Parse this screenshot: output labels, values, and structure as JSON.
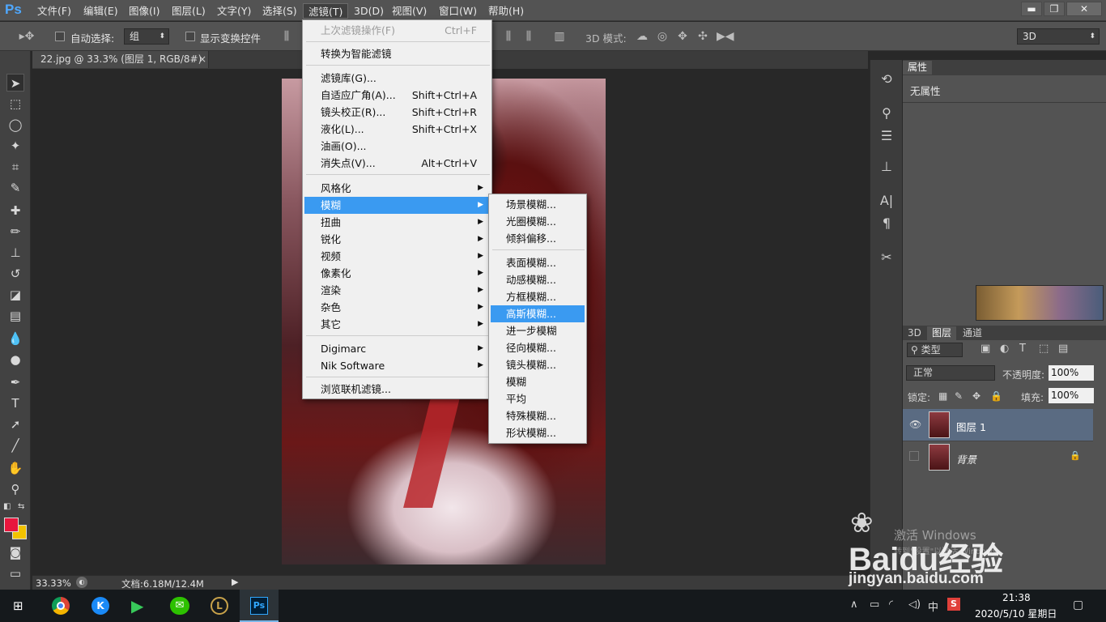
{
  "app": {
    "logo": "Ps"
  },
  "menubar": {
    "items": [
      {
        "label": "文件(F)"
      },
      {
        "label": "编辑(E)"
      },
      {
        "label": "图像(I)"
      },
      {
        "label": "图层(L)"
      },
      {
        "label": "文字(Y)"
      },
      {
        "label": "选择(S)"
      },
      {
        "label": "滤镜(T)"
      },
      {
        "label": "3D(D)"
      },
      {
        "label": "视图(V)"
      },
      {
        "label": "窗口(W)"
      },
      {
        "label": "帮助(H)"
      }
    ]
  },
  "window_controls": {
    "minimize": "▬",
    "restore": "❐",
    "close": "✕"
  },
  "options_bar": {
    "auto_select_label": "自动选择:",
    "auto_select_value": "组",
    "show_transform_label": "显示变换控件",
    "mode_label": "3D 模式:",
    "workspace_value": "3D"
  },
  "document_tab": {
    "title": "22.jpg @ 33.3% (图层 1, RGB/8#) *",
    "close": "×"
  },
  "status_bar": {
    "zoom": "33.33%",
    "doc_info": "文档:6.18M/12.4M"
  },
  "filter_menu": {
    "items": [
      {
        "label": "上次滤镜操作(F)",
        "shortcut": "Ctrl+F",
        "disabled": true
      },
      {
        "label": "转换为智能滤镜"
      },
      {
        "label": "滤镜库(G)..."
      },
      {
        "label": "自适应广角(A)...",
        "shortcut": "Shift+Ctrl+A"
      },
      {
        "label": "镜头校正(R)...",
        "shortcut": "Shift+Ctrl+R"
      },
      {
        "label": "液化(L)...",
        "shortcut": "Shift+Ctrl+X"
      },
      {
        "label": "油画(O)..."
      },
      {
        "label": "消失点(V)...",
        "shortcut": "Alt+Ctrl+V"
      },
      {
        "label": "风格化"
      },
      {
        "label": "模糊"
      },
      {
        "label": "扭曲"
      },
      {
        "label": "锐化"
      },
      {
        "label": "视频"
      },
      {
        "label": "像素化"
      },
      {
        "label": "渲染"
      },
      {
        "label": "杂色"
      },
      {
        "label": "其它"
      },
      {
        "label": "Digimarc"
      },
      {
        "label": "Nik Software"
      },
      {
        "label": "浏览联机滤镜..."
      }
    ]
  },
  "blur_menu": {
    "items": [
      {
        "label": "场景模糊..."
      },
      {
        "label": "光圈模糊..."
      },
      {
        "label": "倾斜偏移..."
      },
      {
        "label": "表面模糊..."
      },
      {
        "label": "动感模糊..."
      },
      {
        "label": "方框模糊..."
      },
      {
        "label": "高斯模糊..."
      },
      {
        "label": "进一步模糊"
      },
      {
        "label": "径向模糊..."
      },
      {
        "label": "镜头模糊..."
      },
      {
        "label": "模糊"
      },
      {
        "label": "平均"
      },
      {
        "label": "特殊模糊..."
      },
      {
        "label": "形状模糊..."
      }
    ]
  },
  "properties_panel": {
    "tab": "属性",
    "content": "无属性"
  },
  "layers_panel": {
    "tabs": [
      "3D",
      "图层",
      "通道"
    ],
    "filter_kind": "类型",
    "blend_mode": "正常",
    "opacity_label": "不透明度:",
    "opacity_value": "100%",
    "lock_label": "锁定:",
    "fill_label": "填充:",
    "fill_value": "100%",
    "layers": [
      {
        "name": "图层 1",
        "visible": true,
        "selected": true
      },
      {
        "name": "背景",
        "visible": false,
        "locked": true
      }
    ]
  },
  "taskbar": {
    "time": "21:38",
    "date": "2020/5/10 星期日",
    "ime": "中",
    "tray_s": "S"
  },
  "watermark": {
    "activate_text": "激活 Windows",
    "activate_sub": "转到\"设置\"以激活 Windows。",
    "brand": "Baidu经验",
    "url": "jingyan.baidu.com"
  },
  "colors": {
    "foreground": "#e8163d",
    "background": "#f2c300",
    "menu_highlight": "#3a9af1"
  }
}
